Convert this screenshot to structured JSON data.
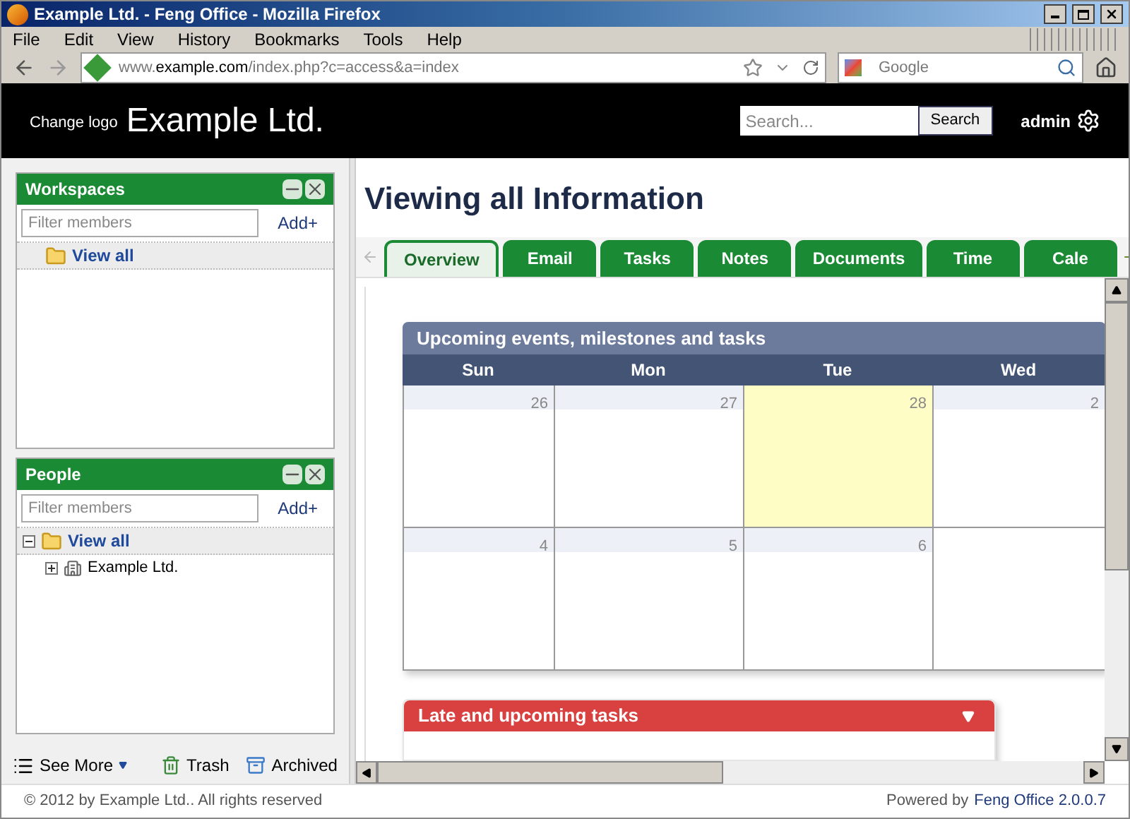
{
  "browser": {
    "title": "Example Ltd. - Feng Office - Mozilla Firefox",
    "menu": [
      "File",
      "Edit",
      "View",
      "History",
      "Bookmarks",
      "Tools",
      "Help"
    ],
    "url": {
      "prefix": "www.",
      "domain": "example.com",
      "path": "/index.php?c=access&a=index"
    },
    "search_placeholder": "Google"
  },
  "header": {
    "change_logo": "Change logo",
    "company": "Example Ltd.",
    "search_placeholder": "Search...",
    "search_button": "Search",
    "user": "admin"
  },
  "sidebar": {
    "panels": [
      {
        "title": "Workspaces",
        "filter_placeholder": "Filter members",
        "add": "Add+",
        "tree": [
          {
            "label": "View all",
            "kind": "folder"
          }
        ]
      },
      {
        "title": "People",
        "filter_placeholder": "Filter members",
        "add": "Add+",
        "tree": [
          {
            "label": "View all",
            "kind": "folder",
            "expanded": true,
            "children": [
              {
                "label": "Example Ltd.",
                "kind": "company",
                "expanded": false
              }
            ]
          }
        ]
      }
    ],
    "bottom": {
      "see_more": "See More",
      "trash": "Trash",
      "archived": "Archived"
    }
  },
  "main": {
    "title": "Viewing all Information",
    "tabs": [
      {
        "label": "Overview",
        "selected": true
      },
      {
        "label": "Email",
        "selected": false
      },
      {
        "label": "Tasks",
        "selected": false
      },
      {
        "label": "Notes",
        "selected": false
      },
      {
        "label": "Documents",
        "selected": false
      },
      {
        "label": "Time",
        "selected": false
      },
      {
        "label": "Cale",
        "selected": false
      }
    ],
    "calendar": {
      "title": "Upcoming events, milestones and tasks",
      "days": [
        "Sun",
        "Mon",
        "Tue",
        "Wed"
      ],
      "weeks": [
        [
          {
            "day": "26",
            "today": false
          },
          {
            "day": "27",
            "today": false
          },
          {
            "day": "28",
            "today": true
          },
          {
            "day": "2",
            "today": false
          }
        ],
        [
          {
            "day": "4",
            "today": false
          },
          {
            "day": "5",
            "today": false
          },
          {
            "day": "6",
            "today": false
          }
        ]
      ]
    },
    "tasks": {
      "title": "Late and upcoming tasks"
    }
  },
  "status_bar": {
    "copyright": "© 2012 by Example Ltd.. All rights reserved",
    "powered_prefix": "Powered by",
    "powered_link": "Feng Office 2.0.0.7"
  }
}
